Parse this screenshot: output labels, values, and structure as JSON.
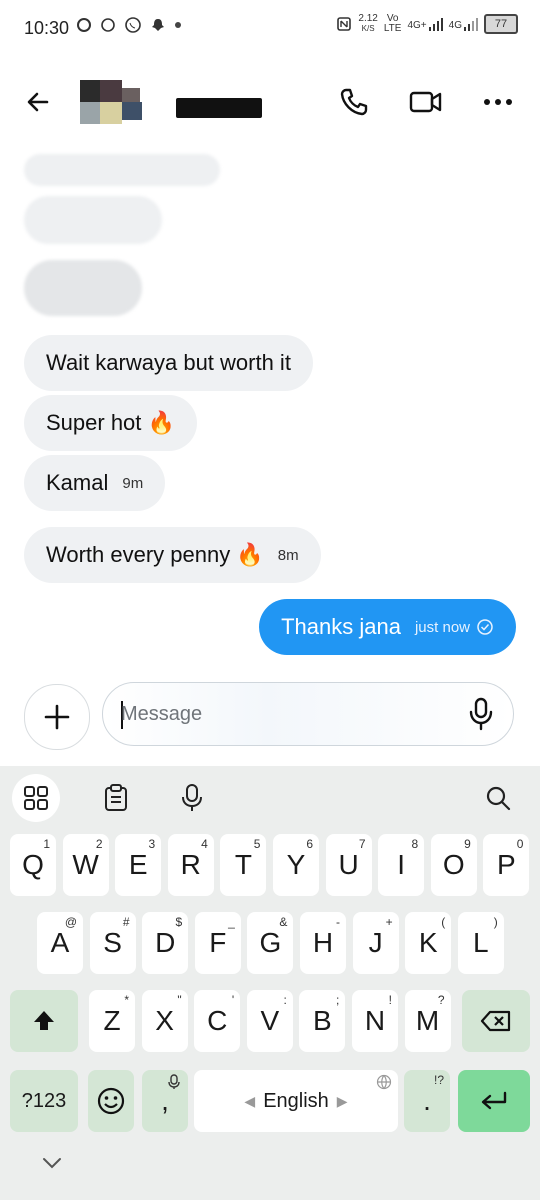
{
  "status_bar": {
    "time": "10:30",
    "net_speed": "2.12",
    "net_speed_unit": "K/S",
    "volte": "Vo",
    "lte": "LTE",
    "signal_1": "4G+",
    "signal_2": "4G",
    "battery": "77"
  },
  "header": {
    "back_icon": "arrow-left-icon",
    "call_icon": "phone-icon",
    "video_icon": "video-camera-icon",
    "more_icon": "more-horizontal-icon"
  },
  "messages": [
    {
      "text": "Wait karwaya but worth it",
      "time": ""
    },
    {
      "text": "Super hot 🔥",
      "time": ""
    },
    {
      "text": "Kamal",
      "time": "9m"
    },
    {
      "text": "Worth every penny 🔥",
      "time": "8m"
    }
  ],
  "outgoing": {
    "text": "Thanks jana",
    "time": "just now"
  },
  "composer": {
    "placeholder": "Message",
    "add_icon": "plus-icon",
    "mic_icon": "microphone-icon"
  },
  "keyboard": {
    "toolbar": [
      "grid-icon",
      "clipboard-icon",
      "microphone-icon",
      "search-icon"
    ],
    "row1": [
      {
        "k": "Q",
        "h": "1"
      },
      {
        "k": "W",
        "h": "2"
      },
      {
        "k": "E",
        "h": "3"
      },
      {
        "k": "R",
        "h": "4"
      },
      {
        "k": "T",
        "h": "5"
      },
      {
        "k": "Y",
        "h": "6"
      },
      {
        "k": "U",
        "h": "7"
      },
      {
        "k": "I",
        "h": "8"
      },
      {
        "k": "O",
        "h": "9"
      },
      {
        "k": "P",
        "h": "0"
      }
    ],
    "row2": [
      {
        "k": "A",
        "h": "@"
      },
      {
        "k": "S",
        "h": "#"
      },
      {
        "k": "D",
        "h": "$"
      },
      {
        "k": "F",
        "h": "_"
      },
      {
        "k": "G",
        "h": "&"
      },
      {
        "k": "H",
        "h": "-"
      },
      {
        "k": "J",
        "h": "+"
      },
      {
        "k": "K",
        "h": "("
      },
      {
        "k": "L",
        "h": ")"
      }
    ],
    "row3": [
      {
        "k": "Z",
        "h": "*"
      },
      {
        "k": "X",
        "h": "\""
      },
      {
        "k": "C",
        "h": "'"
      },
      {
        "k": "V",
        "h": ":"
      },
      {
        "k": "B",
        "h": ";"
      },
      {
        "k": "N",
        "h": "!"
      },
      {
        "k": "M",
        "h": "?"
      }
    ],
    "symbols_label": "?123",
    "comma": ",",
    "space_label": "English",
    "period": ".",
    "period_hint": "!?",
    "shift_icon": "shift-icon",
    "backspace_icon": "backspace-icon",
    "emoji_icon": "emoji-icon",
    "enter_icon": "enter-icon",
    "collapse_icon": "chevron-down-icon"
  },
  "colors": {
    "accent": "#2196f3",
    "bubble": "#eff1f3",
    "key_dark": "#d4e6d5",
    "enter": "#7ed99a"
  }
}
